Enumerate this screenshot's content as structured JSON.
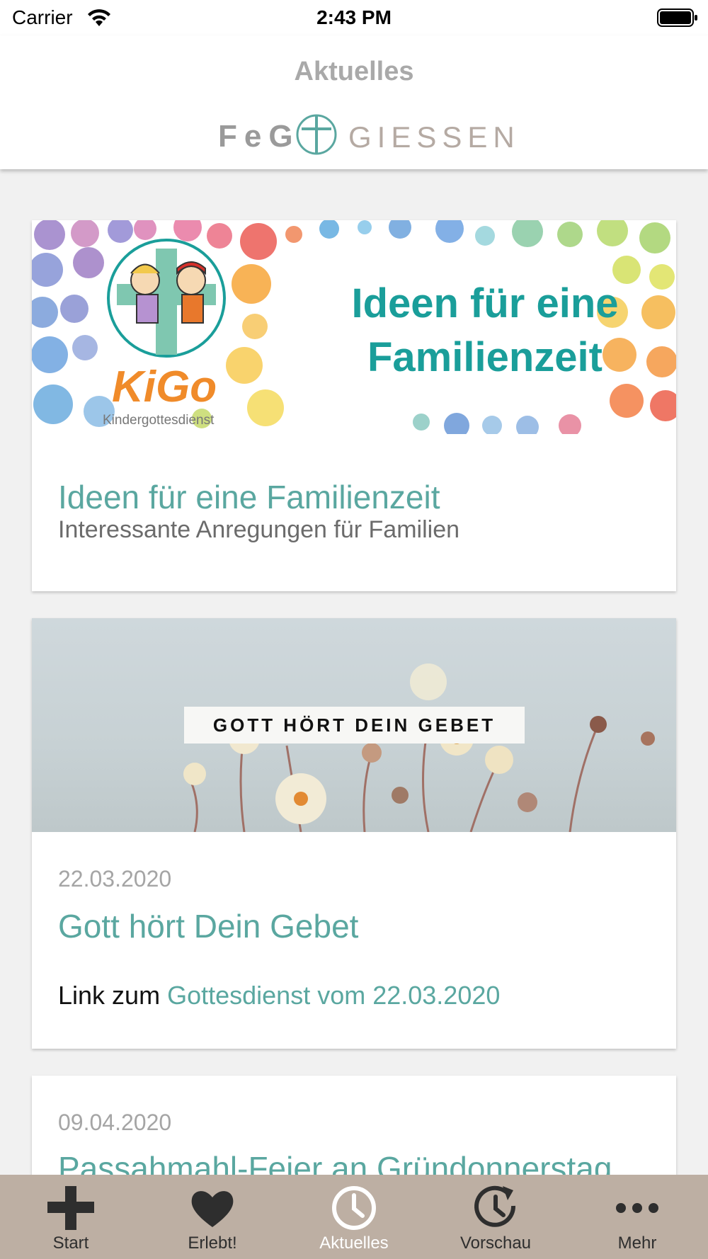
{
  "status_bar": {
    "carrier": "Carrier",
    "time": "2:43 PM"
  },
  "header": {
    "title": "Aktuelles",
    "logo_left": "FeG",
    "logo_right": "GIESSEN"
  },
  "cards": [
    {
      "banner": {
        "headline_line1": "Ideen für eine",
        "headline_line2": "Familienzeit",
        "brand": "KiGo",
        "brand_sub": "Kindergottesdienst"
      },
      "title": "Ideen für eine Familienzeit",
      "subtitle": "Interessante Anregungen für Familien"
    },
    {
      "banner": {
        "label": "GOTT HÖRT DEIN GEBET"
      },
      "date": "22.03.2020",
      "title": "Gott hört Dein Gebet",
      "link_prefix": "Link zum",
      "link_text": "Gottesdienst vom 22.03.2020"
    },
    {
      "date": "09.04.2020",
      "title": "Passahmahl-Feier an Gründonnerstag"
    }
  ],
  "tabs": [
    {
      "label": "Start",
      "icon": "gamepad-icon"
    },
    {
      "label": "Erlebt!",
      "icon": "heart-icon"
    },
    {
      "label": "Aktuelles",
      "icon": "clock-icon",
      "active": true
    },
    {
      "label": "Vorschau",
      "icon": "clock-forward-icon"
    },
    {
      "label": "Mehr",
      "icon": "more-dots-icon"
    }
  ],
  "colors": {
    "accent": "#5aa7a0",
    "tab_bar": "#bdafa3",
    "kigo_teal": "#1a9e9a",
    "kigo_orange": "#f08b2a"
  }
}
